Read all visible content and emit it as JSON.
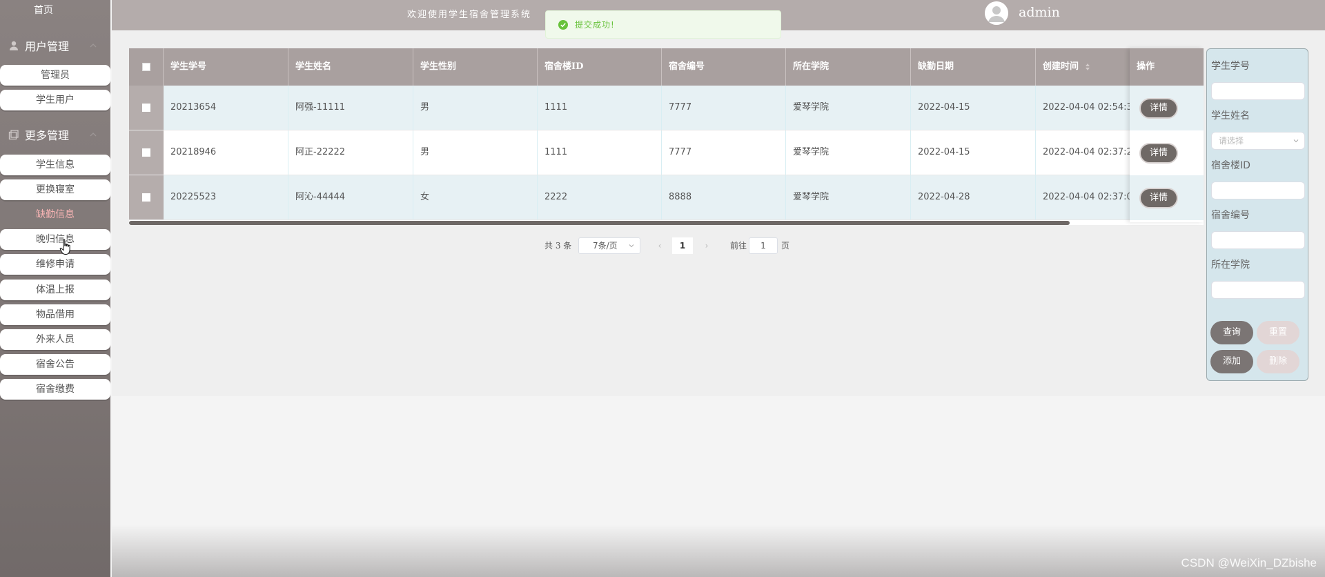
{
  "topbar": {
    "welcome": "欢迎使用学生宿舍管理系统",
    "username": "admin"
  },
  "toast": {
    "message": "提交成功!"
  },
  "sidebar": {
    "home": "首页",
    "sections": [
      {
        "title": "用户管理",
        "items": [
          "管理员",
          "学生用户"
        ]
      },
      {
        "title": "更多管理",
        "items": [
          "学生信息",
          "更换寝室",
          "缺勤信息",
          "晚归信息",
          "维修申请",
          "体温上报",
          "物品借用",
          "外来人员",
          "宿舍公告",
          "宿舍缴费"
        ]
      }
    ],
    "active_item": "缺勤信息"
  },
  "table": {
    "headers": [
      "学生学号",
      "学生姓名",
      "学生性别",
      "宿舍楼ID",
      "宿舍编号",
      "所在学院",
      "缺勤日期",
      "创建时间",
      "操作"
    ],
    "rows": [
      [
        "20213654",
        "阿强-11111",
        "男",
        "1111",
        "7777",
        "爱琴学院",
        "2022-04-15",
        "2022-04-04 02:54:3"
      ],
      [
        "20218946",
        "阿正-22222",
        "男",
        "1111",
        "7777",
        "爱琴学院",
        "2022-04-15",
        "2022-04-04 02:37:2"
      ],
      [
        "20225523",
        "阿沁-44444",
        "女",
        "2222",
        "8888",
        "爱琴学院",
        "2022-04-28",
        "2022-04-04 02:37:0"
      ]
    ],
    "detail_label": "详情"
  },
  "pagination": {
    "total_text": "共 3 条",
    "page_size": "7条/页",
    "prev": "‹",
    "current_page": "1",
    "next": "›",
    "goto_label": "前往",
    "goto_value": "1",
    "page_suffix": "页"
  },
  "search": {
    "fields": [
      {
        "label": "学生学号",
        "value": ""
      },
      {
        "label": "学生姓名",
        "placeholder": "请选择"
      },
      {
        "label": "宿舍楼ID",
        "value": ""
      },
      {
        "label": "宿舍编号",
        "value": ""
      },
      {
        "label": "所在学院",
        "value": ""
      }
    ],
    "buttons": {
      "query": "查询",
      "reset": "重置",
      "add": "添加",
      "delete": "删除"
    }
  },
  "watermark": "CSDN @WeiXin_DZbishe",
  "colors": {
    "sidebar_bg": "#7d7574",
    "topbar_bg": "#b4acab",
    "table_header_bg": "#a9a09f",
    "row_alt_bg": "#e7f1f4",
    "search_panel_bg": "#d5e6ec",
    "active_menu_text": "#f6b3b3",
    "toast_text": "#67c23a",
    "button_dark": "#7b7574",
    "button_light": "#e2d6d6"
  }
}
